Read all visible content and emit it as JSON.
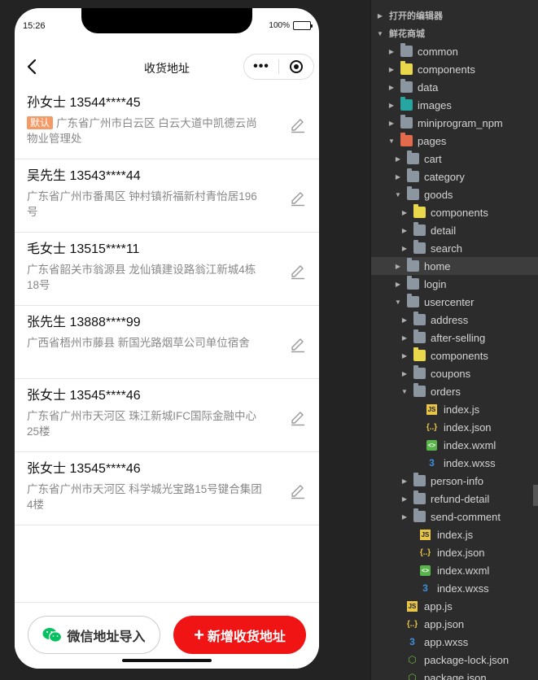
{
  "phone": {
    "status": {
      "time": "15:26",
      "battery": "100%"
    },
    "nav": {
      "title": "收货地址",
      "more": "•••"
    },
    "addresses": [
      {
        "head": "孙女士 13544****45",
        "tag": "默认",
        "body": "广东省广州市白云区 白云大道中凯德云尚物业管理处"
      },
      {
        "head": "吴先生 13543****44",
        "body": "广东省广州市番禺区 钟村镇祈福新村青怡居196号"
      },
      {
        "head": "毛女士 13515****11",
        "body": "广东省韶关市翁源县 龙仙镇建设路翁江新城4栋18号"
      },
      {
        "head": "张先生 13888****99",
        "body": "广西省梧州市藤县 新国光路烟草公司单位宿舍"
      },
      {
        "head": "张女士 13545****46",
        "body": "广东省广州市天河区 珠江新城IFC国际金融中心25楼"
      },
      {
        "head": "张女士 13545****46",
        "body": "广东省广州市天河区 科学城光宝路15号键合集团4楼"
      }
    ],
    "buttons": {
      "wechat_import": "微信地址导入",
      "add_new": "新增收货地址",
      "plus": "+"
    }
  },
  "explorer": {
    "rows": [
      {
        "label": "打开的编辑器",
        "kind": "section",
        "twisty": "right"
      },
      {
        "label": "鲜花商城",
        "kind": "section",
        "twisty": "down"
      },
      {
        "label": "common",
        "kind": "folder",
        "twisty": "right"
      },
      {
        "label": "components",
        "kind": "folder-yellow",
        "twisty": "right"
      },
      {
        "label": "data",
        "kind": "folder",
        "twisty": "right"
      },
      {
        "label": "images",
        "kind": "folder-teal",
        "twisty": "right"
      },
      {
        "label": "miniprogram_npm",
        "kind": "folder",
        "twisty": "right"
      },
      {
        "label": "pages",
        "kind": "folder-red",
        "twisty": "down"
      },
      {
        "label": "cart",
        "kind": "folder",
        "twisty": "right"
      },
      {
        "label": "category",
        "kind": "folder",
        "twisty": "right"
      },
      {
        "label": "goods",
        "kind": "folder",
        "twisty": "down"
      },
      {
        "label": "components",
        "kind": "folder-yellow",
        "twisty": "right"
      },
      {
        "label": "detail",
        "kind": "folder",
        "twisty": "right"
      },
      {
        "label": "search",
        "kind": "folder",
        "twisty": "right"
      },
      {
        "label": "home",
        "kind": "folder",
        "twisty": "right",
        "selected": true
      },
      {
        "label": "login",
        "kind": "folder",
        "twisty": "right"
      },
      {
        "label": "usercenter",
        "kind": "folder",
        "twisty": "down"
      },
      {
        "label": "address",
        "kind": "folder",
        "twisty": "right"
      },
      {
        "label": "after-selling",
        "kind": "folder",
        "twisty": "right"
      },
      {
        "label": "components",
        "kind": "folder-yellow",
        "twisty": "right"
      },
      {
        "label": "coupons",
        "kind": "folder",
        "twisty": "right"
      },
      {
        "label": "orders",
        "kind": "folder",
        "twisty": "down"
      },
      {
        "label": "index.js",
        "kind": "js"
      },
      {
        "label": "index.json",
        "kind": "json"
      },
      {
        "label": "index.wxml",
        "kind": "wxml"
      },
      {
        "label": "index.wxss",
        "kind": "wxss"
      },
      {
        "label": "person-info",
        "kind": "folder",
        "twisty": "right"
      },
      {
        "label": "refund-detail",
        "kind": "folder",
        "twisty": "right"
      },
      {
        "label": "send-comment",
        "kind": "folder",
        "twisty": "right"
      },
      {
        "label": "index.js",
        "kind": "js"
      },
      {
        "label": "index.json",
        "kind": "json"
      },
      {
        "label": "index.wxml",
        "kind": "wxml"
      },
      {
        "label": "index.wxss",
        "kind": "wxss"
      },
      {
        "label": "app.js",
        "kind": "js"
      },
      {
        "label": "app.json",
        "kind": "json"
      },
      {
        "label": "app.wxss",
        "kind": "wxss"
      },
      {
        "label": "package-lock.json",
        "kind": "npmjs"
      },
      {
        "label": "package.json",
        "kind": "npmjs"
      }
    ]
  }
}
